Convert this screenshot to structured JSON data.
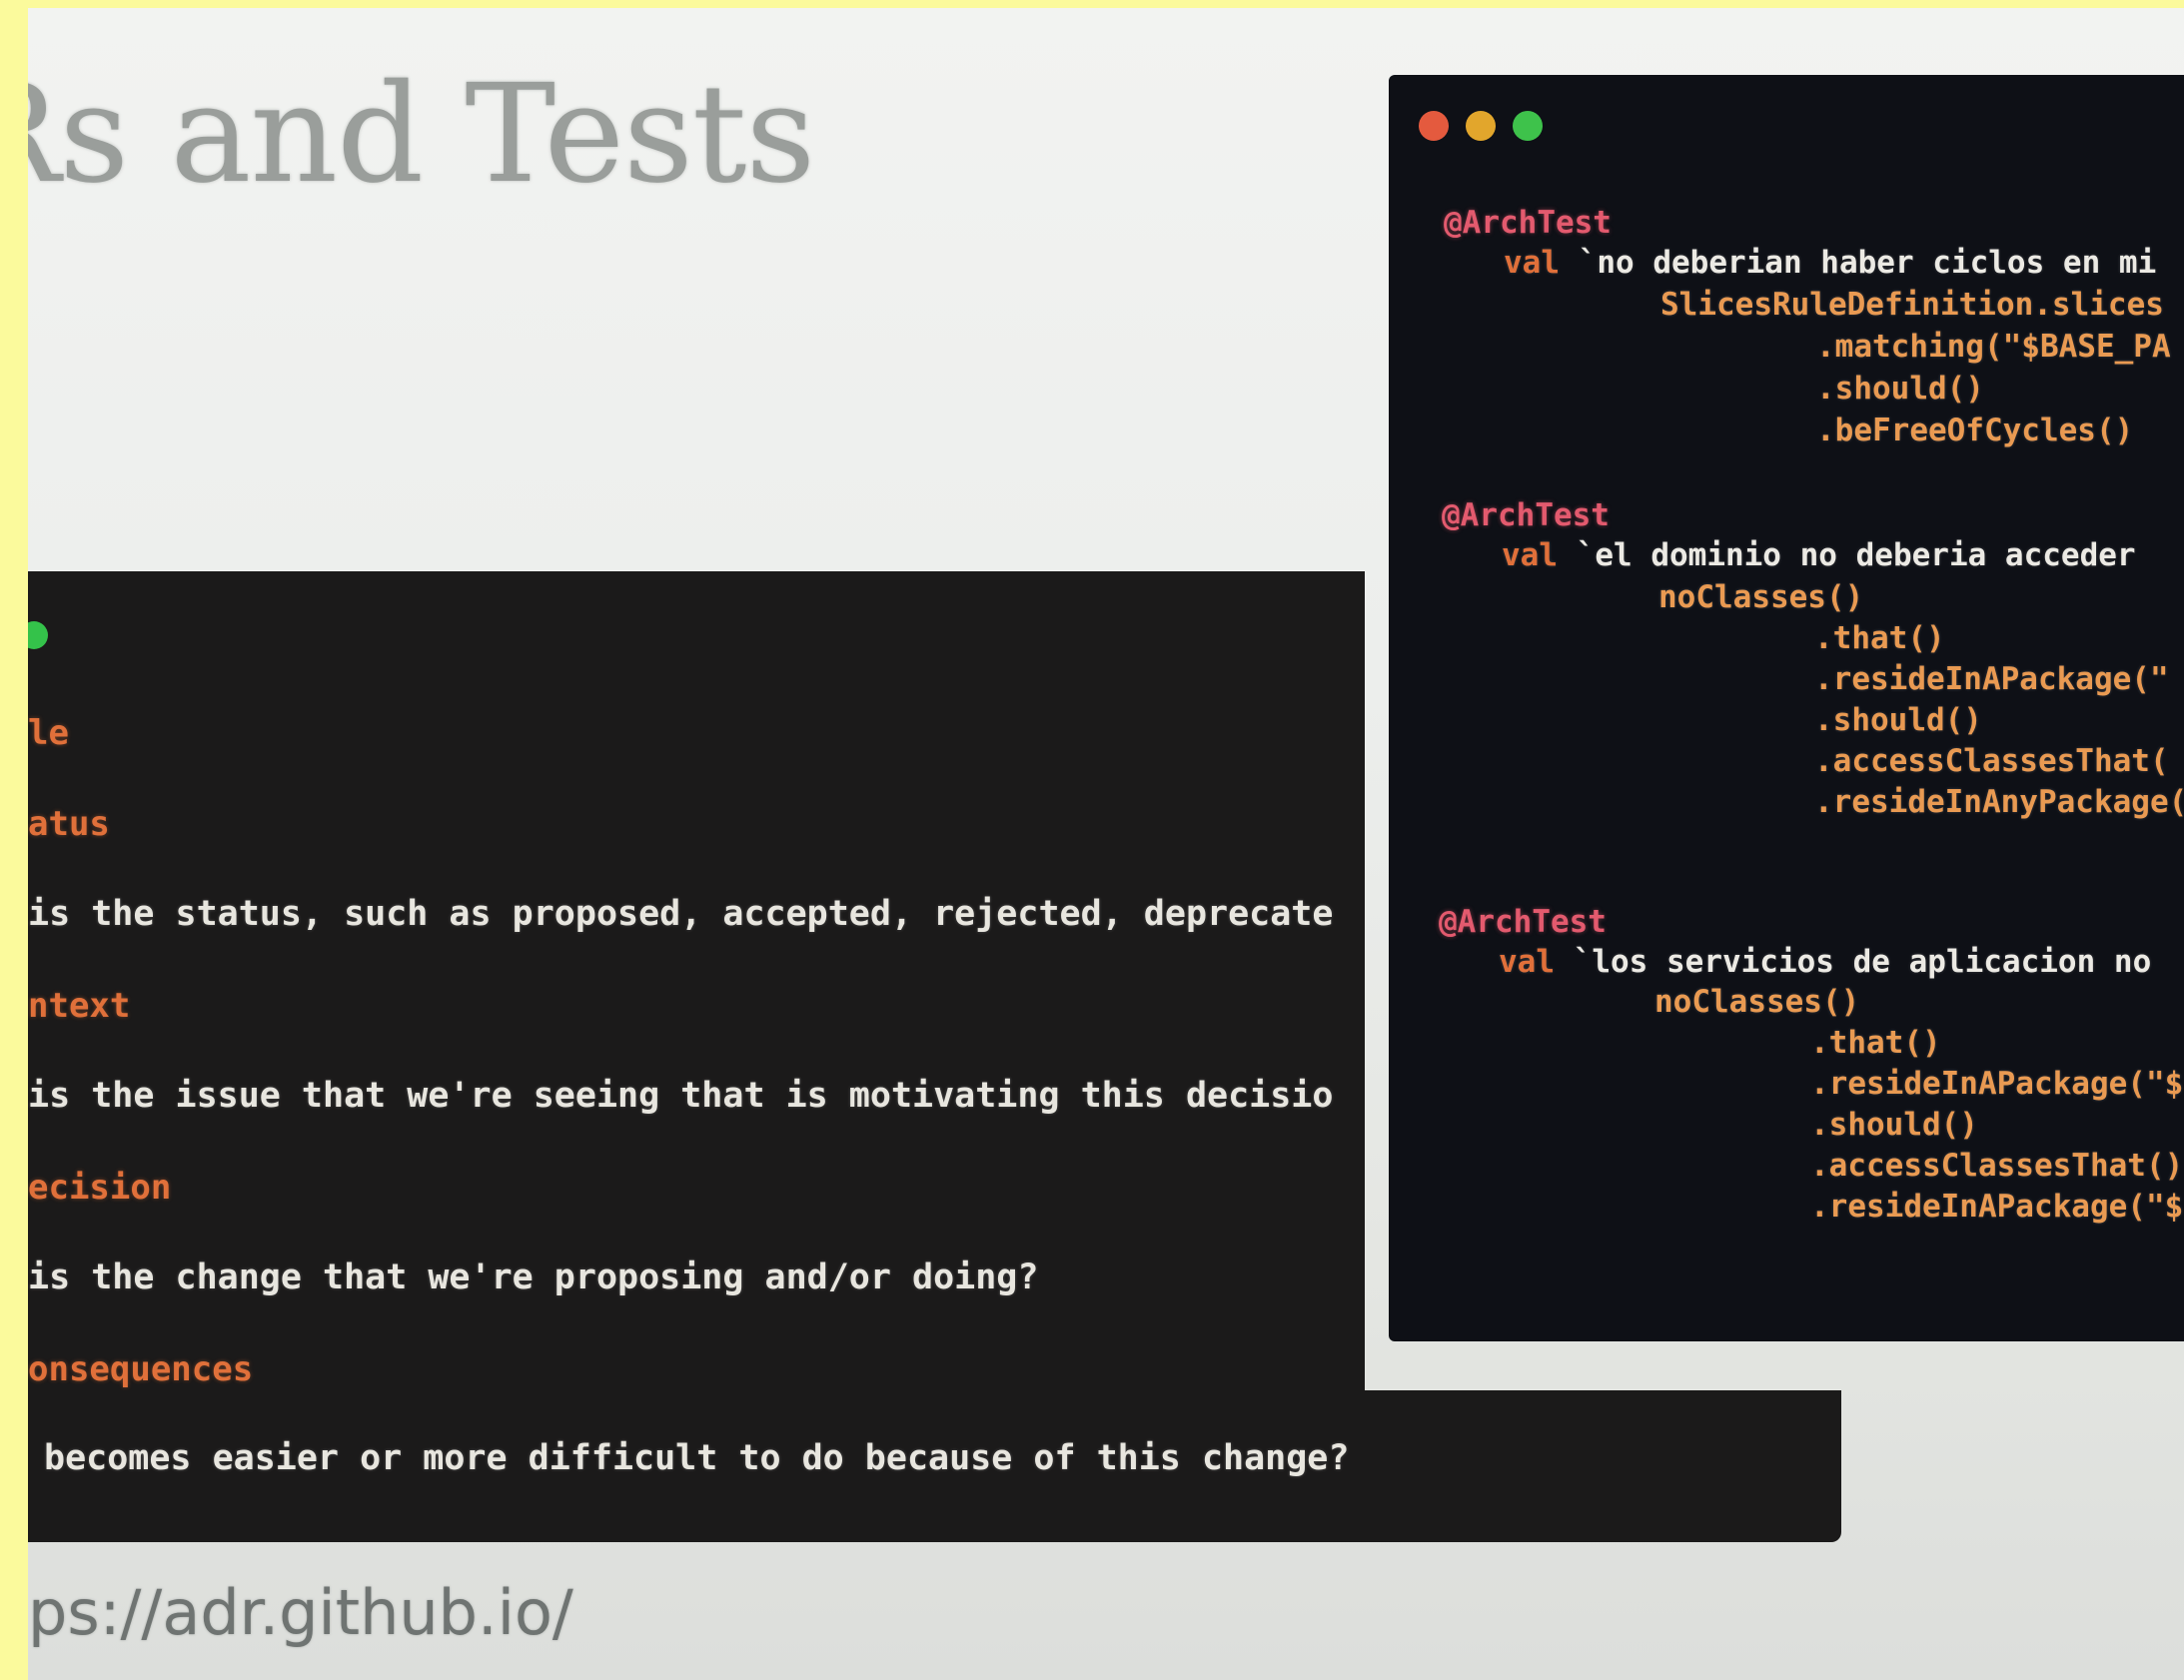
{
  "slide": {
    "title": "Rs and Tests",
    "url": "ps://adr.github.io/"
  },
  "adr_template": {
    "sections": [
      {
        "heading": "le",
        "body": ""
      },
      {
        "heading": "atus",
        "body": "is the status, such as proposed, accepted, rejected, deprecate"
      },
      {
        "heading": "ntext",
        "body": "is the issue that we're seeing that is motivating this decisio"
      },
      {
        "heading": "ecision",
        "body": "is the change that we're proposing and/or doing?"
      },
      {
        "heading": "onsequences",
        "body": "becomes easier or more difficult to do because of this change?"
      }
    ]
  },
  "code_window": {
    "tests": [
      {
        "annotation": "@ArchTest",
        "keyword": "val",
        "name": "`no deberian haber ciclos en mi",
        "chain": [
          "SlicesRuleDefinition.slices",
          ".matching(\"$BASE_PA",
          ".should()",
          ".beFreeOfCycles()"
        ]
      },
      {
        "annotation": "@ArchTest",
        "keyword": "val",
        "name": "`el dominio no deberia acceder",
        "chain": [
          "noClasses()",
          ".that()",
          ".resideInAPackage(\"",
          ".should()",
          ".accessClassesThat(",
          ".resideInAnyPackage("
        ]
      },
      {
        "annotation": "@ArchTest",
        "keyword": "val",
        "name": "`los servicios de aplicacion no",
        "chain": [
          "noClasses()",
          ".that()",
          ".resideInAPackage(\"$",
          ".should()",
          ".accessClassesThat()",
          ".resideInAPackage(\"$"
        ]
      }
    ]
  },
  "colors": {
    "frame": "#fbfa9c",
    "slide_bg": "#eceeec",
    "panel_bg": "#1b1a1a",
    "code_bg": "#0e1016",
    "heading": "#e0703a",
    "annotation": "#e35a6e"
  }
}
